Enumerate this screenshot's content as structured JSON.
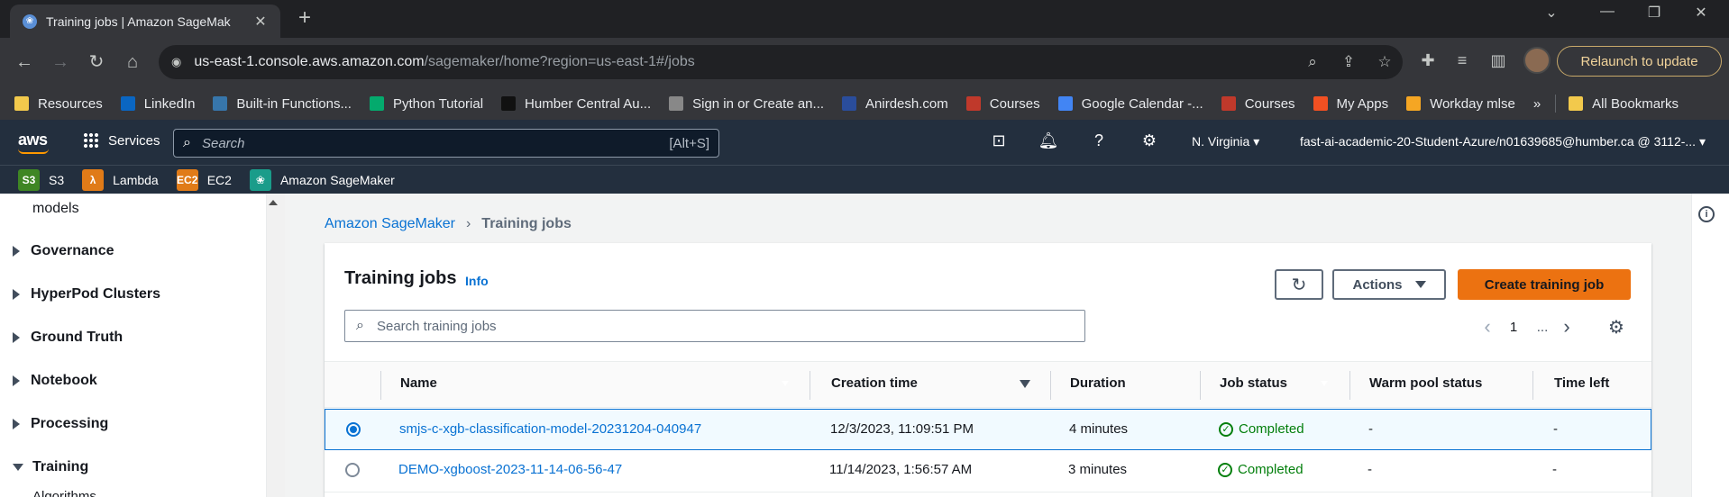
{
  "browser": {
    "tab_title": "Training jobs | Amazon SageMak",
    "url_host": "us-east-1.console.aws.amazon.com",
    "url_path": "/sagemaker/home?region=us-east-1#/jobs",
    "relaunch_label": "Relaunch to update",
    "bookmarks": [
      {
        "label": "Resources",
        "color": "#f2c94c"
      },
      {
        "label": "LinkedIn",
        "color": "#0a66c2"
      },
      {
        "label": "Built-in Functions...",
        "color": "#3776ab"
      },
      {
        "label": "Python Tutorial",
        "color": "#04aa6d"
      },
      {
        "label": "Humber Central Au...",
        "color": "#111111"
      },
      {
        "label": "Sign in or Create an...",
        "color": "#888888"
      },
      {
        "label": "Anirdesh.com",
        "color": "#2a4d9b"
      },
      {
        "label": "Courses",
        "color": "#c0392b"
      },
      {
        "label": "Google Calendar -...",
        "color": "#4285f4"
      },
      {
        "label": "Courses",
        "color": "#c0392b"
      },
      {
        "label": "My Apps",
        "color": "#f25022"
      },
      {
        "label": "Workday mlse",
        "color": "#f5a623"
      }
    ],
    "bookmarks_more": "»",
    "all_bookmarks": "All Bookmarks"
  },
  "aws_header": {
    "logo": "aws",
    "services_label": "Services",
    "search_placeholder": "Search",
    "search_shortcut": "[Alt+S]",
    "region": "N. Virginia ▾",
    "account": "fast-ai-academic-20-Student-Azure/n01639685@humber.ca @ 3112-... ▾",
    "favorites": [
      {
        "label": "S3",
        "abbr": "S3",
        "color": "#3f8624"
      },
      {
        "label": "Lambda",
        "abbr": "λ",
        "color": "#e07b18"
      },
      {
        "label": "EC2",
        "abbr": "EC2",
        "color": "#e07b18"
      },
      {
        "label": "Amazon SageMaker",
        "abbr": "❀",
        "color": "#1a9c8a"
      }
    ]
  },
  "sidenav": {
    "top_item": "models",
    "sections": [
      {
        "label": "Governance",
        "open": false
      },
      {
        "label": "HyperPod Clusters",
        "open": false
      },
      {
        "label": "Ground Truth",
        "open": false
      },
      {
        "label": "Notebook",
        "open": false
      },
      {
        "label": "Processing",
        "open": false
      },
      {
        "label": "Training",
        "open": true
      }
    ],
    "sub_item": "Algorithms"
  },
  "breadcrumb": {
    "root": "Amazon SageMaker",
    "current": "Training jobs"
  },
  "panel": {
    "title": "Training jobs",
    "info": "Info",
    "actions_label": "Actions",
    "create_label": "Create training job",
    "search_placeholder": "Search training jobs",
    "page_number": "1",
    "page_more": "..."
  },
  "table": {
    "columns": [
      "Name",
      "Creation time",
      "Duration",
      "Job status",
      "Warm pool status",
      "Time left"
    ],
    "rows": [
      {
        "selected": true,
        "name": "smjs-c-xgb-classification-model-20231204-040947",
        "created": "12/3/2023, 11:09:51 PM",
        "duration": "4 minutes",
        "status": "Completed",
        "warm_pool": "-",
        "time_left": "-"
      },
      {
        "selected": false,
        "name": "DEMO-xgboost-2023-11-14-06-56-47",
        "created": "11/14/2023, 1:56:57 AM",
        "duration": "3 minutes",
        "status": "Completed",
        "warm_pool": "-",
        "time_left": "-"
      }
    ]
  }
}
